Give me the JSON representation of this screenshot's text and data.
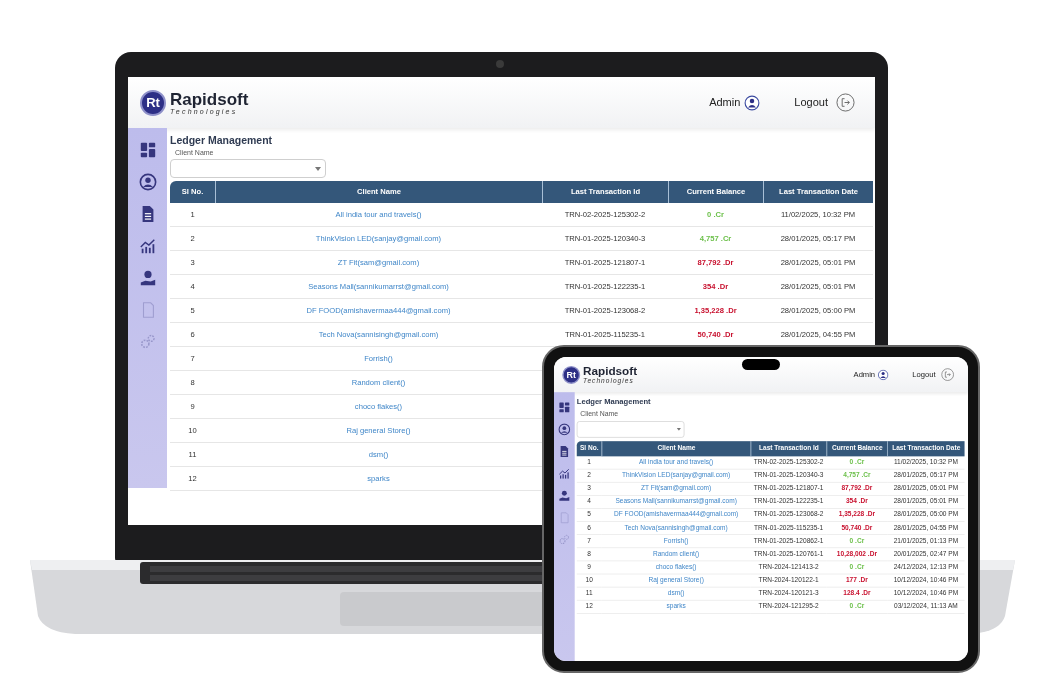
{
  "laptop": {
    "header": {
      "logo_mark": "Rt",
      "brand": "Rapidsoft",
      "tagline": "Technologies",
      "user": "Admin",
      "logout": "Logout"
    },
    "page_title": "Ledger Management",
    "client_filter": {
      "label": "Client Name"
    },
    "table": {
      "columns": [
        "Sl No.",
        "Client Name",
        "Last Transaction Id",
        "Current Balance",
        "Last Transaction Date"
      ],
      "rows": [
        {
          "sl": "1",
          "client": "All india tour and travels()",
          "transaction_id": "TRN-02-2025-125302-2",
          "balance": "0 .Cr",
          "kind": "credit",
          "date": "11/02/2025, 10:32 PM"
        },
        {
          "sl": "2",
          "client": "ThinkVision LED(sanjay@gmail.com)",
          "transaction_id": "TRN-01-2025-120340-3",
          "balance": "4,757 .Cr",
          "kind": "credit",
          "date": "28/01/2025, 05:17 PM"
        },
        {
          "sl": "3",
          "client": "ZT Fit(sam@gmail.com)",
          "transaction_id": "TRN-01-2025-121807-1",
          "balance": "87,792 .Dr",
          "kind": "debit",
          "date": "28/01/2025, 05:01 PM"
        },
        {
          "sl": "4",
          "client": "Seasons Mall(sannikumarrst@gmail.com)",
          "transaction_id": "TRN-01-2025-122235-1",
          "balance": "354 .Dr",
          "kind": "debit",
          "date": "28/01/2025, 05:01 PM"
        },
        {
          "sl": "5",
          "client": "DF FOOD(amishavermaa444@gmail.com)",
          "transaction_id": "TRN-01-2025-123068-2",
          "balance": "1,35,228 .Dr",
          "kind": "debit",
          "date": "28/01/2025, 05:00 PM"
        },
        {
          "sl": "6",
          "client": "Tech Nova(sannisingh@gmail.com)",
          "transaction_id": "TRN-01-2025-115235-1",
          "balance": "50,740 .Dr",
          "kind": "debit",
          "date": "28/01/2025, 04:55 PM"
        },
        {
          "sl": "7",
          "client": "Forrish()"
        },
        {
          "sl": "8",
          "client": "Random client()"
        },
        {
          "sl": "9",
          "client": "choco flakes()"
        },
        {
          "sl": "10",
          "client": "Raj general Store()"
        },
        {
          "sl": "11",
          "client": "dsm()"
        },
        {
          "sl": "12",
          "client": "sparks"
        }
      ]
    }
  },
  "tablet": {
    "header": {
      "logo_mark": "Rt",
      "brand": "Rapidsoft",
      "tagline": "Technologies",
      "user": "Admin",
      "logout": "Logout"
    },
    "page_title": "Ledger Management",
    "client_filter": {
      "label": "Client Name"
    },
    "table": {
      "columns": [
        "Sl No.",
        "Client Name",
        "Last Transaction Id",
        "Current Balance",
        "Last Transaction Date"
      ],
      "rows": [
        {
          "sl": "1",
          "client": "All india tour and travels()",
          "transaction_id": "TRN-02-2025-125302-2",
          "balance": "0 .Cr",
          "kind": "credit",
          "date": "11/02/2025, 10:32 PM"
        },
        {
          "sl": "2",
          "client": "ThinkVision LED(sanjay@gmail.com)",
          "transaction_id": "TRN-01-2025-120340-3",
          "balance": "4,757 .Cr",
          "kind": "credit",
          "date": "28/01/2025, 05:17 PM"
        },
        {
          "sl": "3",
          "client": "ZT Fit(sam@gmail.com)",
          "transaction_id": "TRN-01-2025-121807-1",
          "balance": "87,792 .Dr",
          "kind": "debit",
          "date": "28/01/2025, 05:01 PM"
        },
        {
          "sl": "4",
          "client": "Seasons Mall(sannikumarrst@gmail.com)",
          "transaction_id": "TRN-01-2025-122235-1",
          "balance": "354 .Dr",
          "kind": "debit",
          "date": "28/01/2025, 05:01 PM"
        },
        {
          "sl": "5",
          "client": "DF FOOD(amishavermaa444@gmail.com)",
          "transaction_id": "TRN-01-2025-123068-2",
          "balance": "1,35,228 .Dr",
          "kind": "debit",
          "date": "28/01/2025, 05:00 PM"
        },
        {
          "sl": "6",
          "client": "Tech Nova(sannisingh@gmail.com)",
          "transaction_id": "TRN-01-2025-115235-1",
          "balance": "50,740 .Dr",
          "kind": "debit",
          "date": "28/01/2025, 04:55 PM"
        },
        {
          "sl": "7",
          "client": "Forrish()",
          "transaction_id": "TRN-01-2025-120862-1",
          "balance": "0 .Cr",
          "kind": "credit",
          "date": "21/01/2025, 01:13 PM"
        },
        {
          "sl": "8",
          "client": "Random client()",
          "transaction_id": "TRN-01-2025-120761-1",
          "balance": "10,28,002 .Dr",
          "kind": "debit",
          "date": "20/01/2025, 02:47 PM"
        },
        {
          "sl": "9",
          "client": "choco flakes()",
          "transaction_id": "TRN-2024-121413-2",
          "balance": "0 .Cr",
          "kind": "credit",
          "date": "24/12/2024, 12:13 PM"
        },
        {
          "sl": "10",
          "client": "Raj general Store()",
          "transaction_id": "TRN-2024-120122-1",
          "balance": "177 .Dr",
          "kind": "debit",
          "date": "10/12/2024, 10:46 PM"
        },
        {
          "sl": "11",
          "client": "dsm()",
          "transaction_id": "TRN-2024-120121-3",
          "balance": "128.4 .Dr",
          "kind": "debit",
          "date": "10/12/2024, 10:46 PM"
        },
        {
          "sl": "12",
          "client": "sparks",
          "transaction_id": "TRN-2024-121295-2",
          "balance": "0 .Cr",
          "kind": "credit",
          "date": "03/12/2024, 11:13 AM"
        }
      ]
    }
  }
}
